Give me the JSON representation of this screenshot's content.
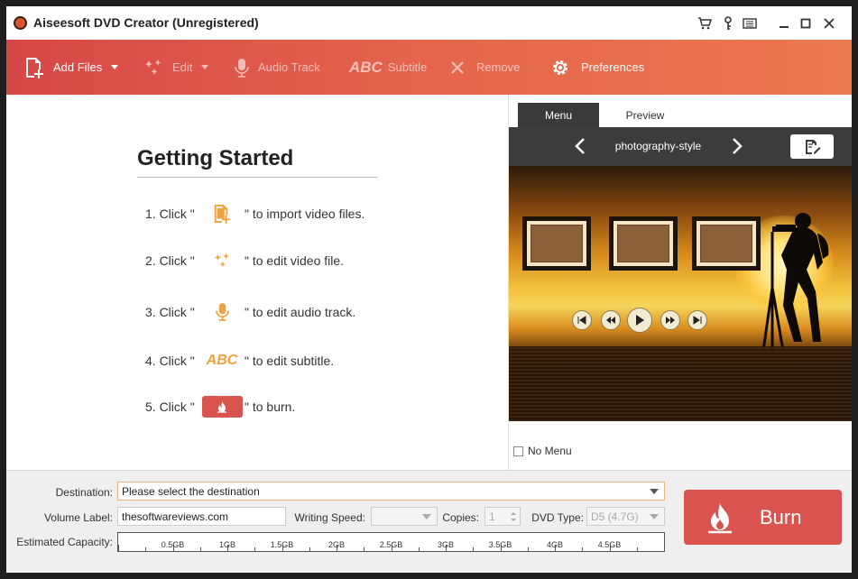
{
  "window": {
    "title": "Aiseesoft DVD Creator (Unregistered)"
  },
  "toolbar": {
    "add_files": "Add Files",
    "edit": "Edit",
    "audio_track": "Audio Track",
    "subtitle": "Subtitle",
    "remove": "Remove",
    "preferences": "Preferences"
  },
  "getting_started": {
    "title": "Getting Started",
    "steps": [
      {
        "pre": "1. Click \"",
        "post": "\" to import video files."
      },
      {
        "pre": "2. Click \"",
        "post": "\" to edit video file."
      },
      {
        "pre": "3. Click \"",
        "post": "\" to edit audio track."
      },
      {
        "pre": "4. Click \"",
        "post": "\" to edit subtitle."
      },
      {
        "pre": "5. Click \"",
        "post": "\" to burn."
      }
    ],
    "abc_text": "ABC"
  },
  "preview_panel": {
    "tabs": [
      "Menu",
      "Preview"
    ],
    "template_name": "photography-style",
    "no_menu_label": "No Menu",
    "no_menu_checked": false
  },
  "bottom": {
    "destination_label": "Destination:",
    "destination_placeholder": "Please select the destination",
    "volume_label": "Volume Label:",
    "volume_value": "thesoftwareviews.com",
    "writing_speed_label": "Writing Speed:",
    "copies_label": "Copies:",
    "copies_value": "1",
    "dvd_type_label": "DVD Type:",
    "dvd_type_value": "D5 (4.7G)",
    "capacity_label": "Estimated Capacity:",
    "capacity_ticks": [
      "0.5GB",
      "1GB",
      "1.5GB",
      "2GB",
      "2.5GB",
      "3GB",
      "3.5GB",
      "4GB",
      "4.5GB"
    ],
    "burn_label": "Burn"
  },
  "colors": {
    "accent": "#d9534f",
    "toolbar_start": "#d64747",
    "toolbar_end": "#ec7a4f",
    "step_icon": "#f0a23a"
  }
}
